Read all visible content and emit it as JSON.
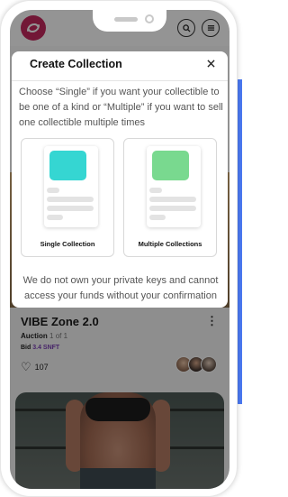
{
  "modal": {
    "title": "Create Collection",
    "description": "Choose “Single” if you want your collectible to be one of a kind or “Multiple” if you want to sell one collectible multiple times",
    "options": [
      {
        "label": "Single Collection",
        "accent": "#35d6d2"
      },
      {
        "label": "Multiple Collections",
        "accent": "#79d98f"
      }
    ],
    "footer": "We do not own your private keys and cannot access your funds without your confirmation",
    "close_icon": "close-icon"
  },
  "header": {
    "logo_icon": "logo-icon",
    "search_icon": "search-icon",
    "menu_icon": "menu-icon"
  },
  "item": {
    "title": "VIBE Zone 2.0",
    "auction_label": "Auction",
    "auction_count": "1 of 1",
    "bid_label": "Bid",
    "bid_value": "3.4 SNFT",
    "likes": "107"
  },
  "colors": {
    "brand": "#c4295d",
    "bid_accent": "#7b3fb5",
    "overlay": "rgba(0,0,0,0.42)"
  }
}
